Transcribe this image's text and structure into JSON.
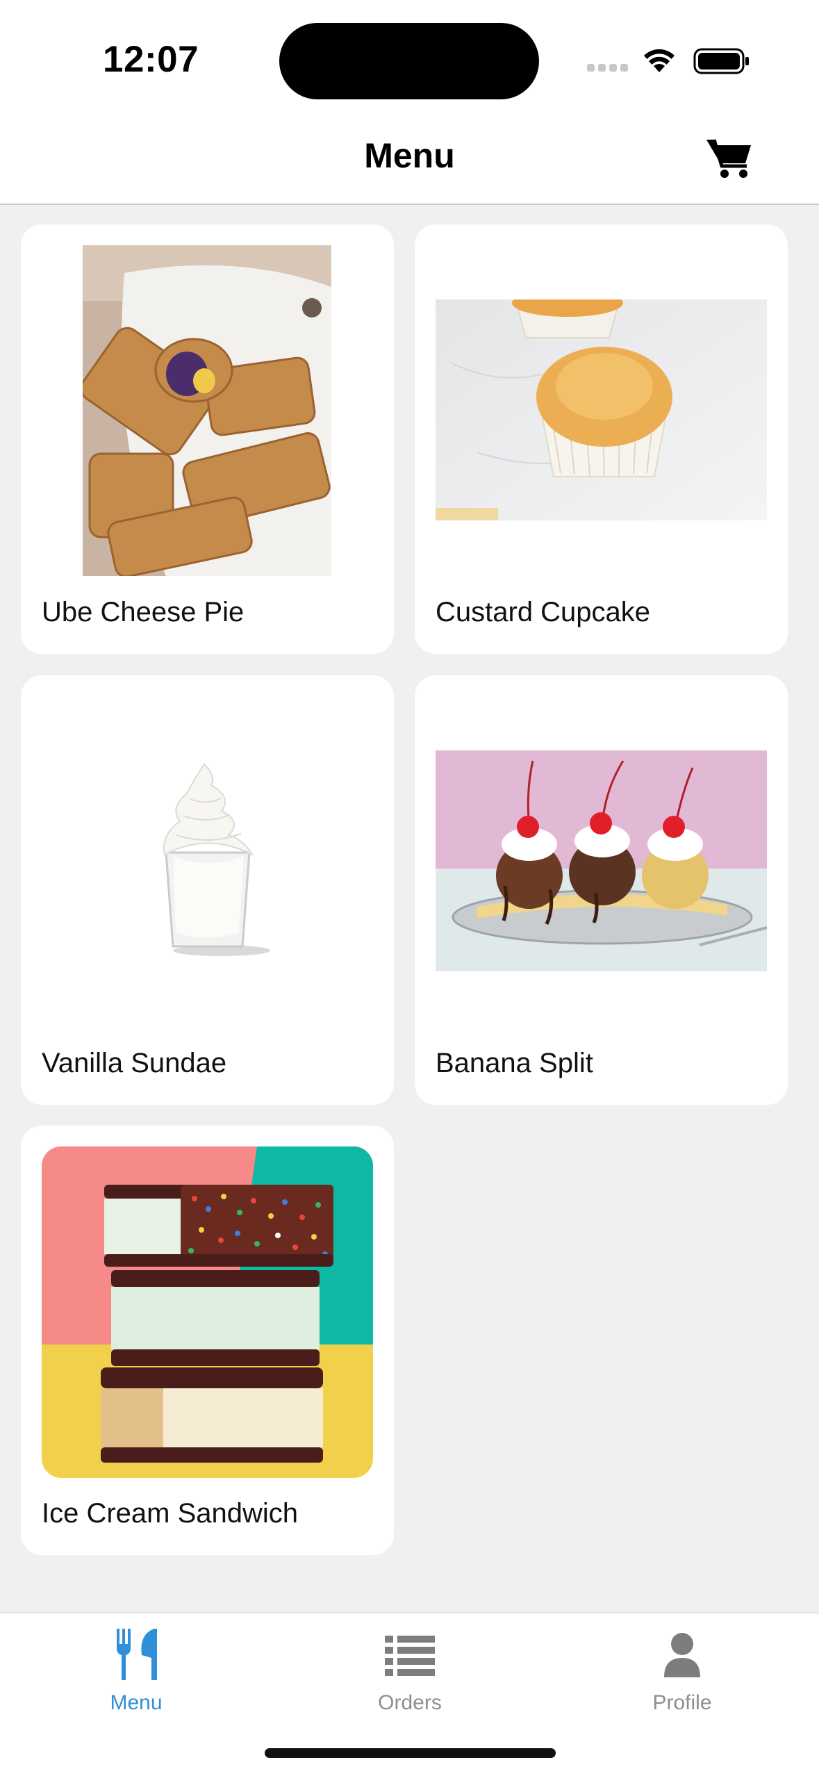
{
  "status_bar": {
    "time": "12:07"
  },
  "nav": {
    "title": "Menu",
    "cart_icon": "cart-icon"
  },
  "menu_items": [
    {
      "name": "Ube Cheese Pie"
    },
    {
      "name": "Custard Cupcake"
    },
    {
      "name": "Vanilla Sundae"
    },
    {
      "name": "Banana Split"
    },
    {
      "name": "Ice Cream Sandwich"
    }
  ],
  "tabs": [
    {
      "label": "Menu",
      "icon": "fork-knife-icon",
      "active": true
    },
    {
      "label": "Orders",
      "icon": "list-icon",
      "active": false
    },
    {
      "label": "Profile",
      "icon": "person-icon",
      "active": false
    }
  ],
  "colors": {
    "accent": "#2f8fd8",
    "background": "#f0f0f0",
    "inactive": "#8e8e93"
  }
}
